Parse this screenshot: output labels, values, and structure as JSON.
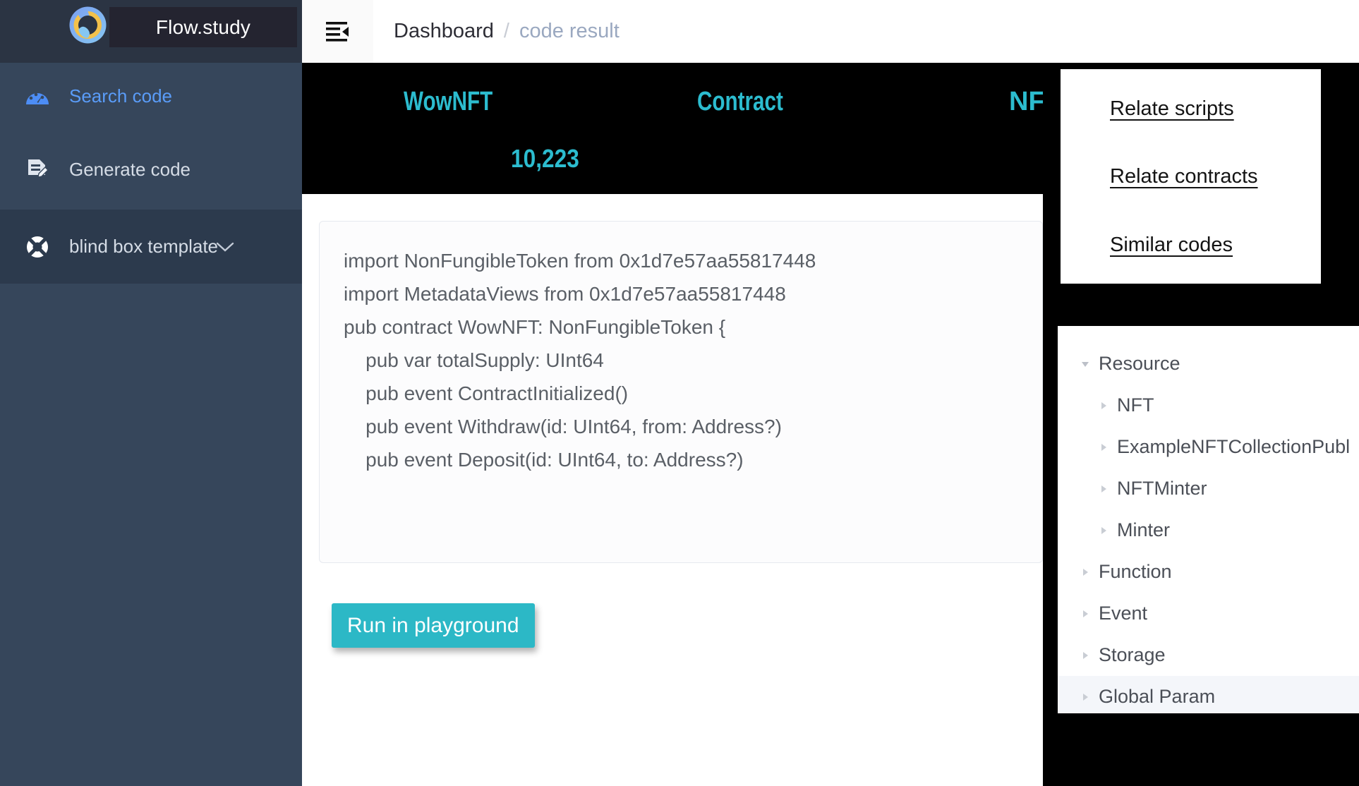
{
  "sidebar": {
    "brand": {
      "title": "Flow.study",
      "logo_icon": "flow-logo-icon"
    },
    "items": [
      {
        "label": "Search code",
        "icon": "dashboard-gauge-icon",
        "active": true
      },
      {
        "label": "Generate code",
        "icon": "document-edit-icon",
        "active": false
      },
      {
        "label": "blind box template",
        "icon": "blind-box-icon",
        "expand_icon": "chevron-down-icon",
        "active": false
      }
    ]
  },
  "topbar": {
    "menu_icon": "menu-fold-icon",
    "breadcrumb": {
      "root": "Dashboard",
      "separator": "/",
      "current": "code result"
    }
  },
  "banner": {
    "name": "WowNFT",
    "type": "Contract",
    "category": "NFT",
    "count": "10,223",
    "accent_color": "#2cbccf",
    "background_color": "#000000"
  },
  "code": {
    "lines": [
      "import NonFungibleToken from 0x1d7e57aa55817448",
      "import MetadataViews from 0x1d7e57aa55817448",
      "",
      "pub contract WowNFT: NonFungibleToken {",
      "",
      "    pub var totalSupply: UInt64",
      "",
      "    pub event ContractInitialized()",
      "    pub event Withdraw(id: UInt64, from: Address?)",
      "    pub event Deposit(id: UInt64, to: Address?)"
    ]
  },
  "actions": {
    "run_label": "Run in playground",
    "run_color": "#2cb8c6"
  },
  "relate_panel": {
    "links": [
      {
        "label": "Relate scripts"
      },
      {
        "label": "Relate contracts"
      },
      {
        "label": "Similar codes"
      }
    ]
  },
  "tree_panel": {
    "nodes": [
      {
        "label": "Resource",
        "depth": 0,
        "expanded": true,
        "selected": false
      },
      {
        "label": "NFT",
        "depth": 1,
        "expanded": false,
        "selected": false
      },
      {
        "label": "ExampleNFTCollectionPubl",
        "depth": 1,
        "expanded": false,
        "selected": false
      },
      {
        "label": "NFTMinter",
        "depth": 1,
        "expanded": false,
        "selected": false
      },
      {
        "label": "Minter",
        "depth": 1,
        "expanded": false,
        "selected": false
      },
      {
        "label": "Function",
        "depth": 0,
        "expanded": false,
        "selected": false
      },
      {
        "label": "Event",
        "depth": 0,
        "expanded": false,
        "selected": false
      },
      {
        "label": "Storage",
        "depth": 0,
        "expanded": false,
        "selected": false
      },
      {
        "label": "Global Param",
        "depth": 0,
        "expanded": false,
        "selected": true
      }
    ]
  }
}
